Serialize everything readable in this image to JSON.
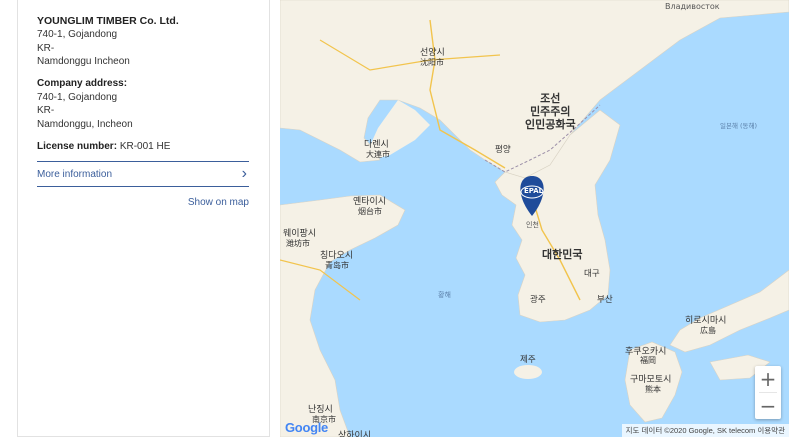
{
  "company": {
    "name": "YOUNGLIM TIMBER Co. Ltd.",
    "address_lines": [
      "740-1, Gojandong",
      "KR-",
      "Namdonggu Incheon"
    ],
    "company_address_label": "Company address:",
    "company_address_lines": [
      "740-1, Gojandong",
      "KR-",
      "Namdonggu, Incheon"
    ],
    "license_label": "License number:",
    "license_value": "KR-001 HE"
  },
  "actions": {
    "more_information": "More information",
    "more_chevron": "›",
    "show_on_map": "Show on map"
  },
  "map": {
    "marker_text": "EPAL",
    "marker_color": "#1f4b9a",
    "labels": {
      "north_korea": [
        "조선",
        "민주주의",
        "인민공화국"
      ],
      "south_korea": "대한민국",
      "pyongyang": "평양",
      "incheon": "인천",
      "daegu": "대구",
      "gwangju": "광주",
      "busan": "부산",
      "jeju": "제주",
      "dalian_ko": "다렌시",
      "dalian_zh": "大連市",
      "shenyang_ko": "선양시",
      "shenyang_zh": "沈阳市",
      "yantai_ko": "옌타이시",
      "yantai_zh": "烟台市",
      "qingdao_ko": "칭다오시",
      "qingdao_zh": "青岛市",
      "weifang_ko": "웨이팡시",
      "weifang_zh": "潍坊市",
      "hiroshima_ko": "히로시마시",
      "hiroshima_ja": "広島",
      "fukuoka_ko": "후쿠오카시",
      "fukuoka_ja": "福岡",
      "kumamoto_ko": "구마모토시",
      "kumamoto_ja": "熊本",
      "nanjing_ko": "난징시",
      "nanjing_zh": "南京市",
      "shanghai_ko": "상하이시",
      "vladivostok": "Владивосток",
      "sea_east": "일본해 (동해)",
      "sea_yellow": "황해"
    },
    "zoom_in": "+",
    "zoom_out": "−",
    "google": "Google",
    "attribution": "지도 데이터 ©2020 Google, SK telecom   이용약관"
  }
}
